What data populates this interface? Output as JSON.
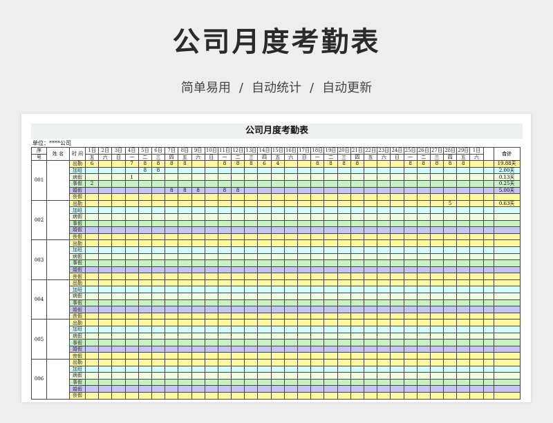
{
  "page": {
    "title": "公司月度考勤表",
    "subtitle": [
      "简单易用",
      "自动统计",
      "自动更新"
    ],
    "separator": "/"
  },
  "sheet": {
    "title": "公司月度考勤表",
    "unit": "单位：****公司",
    "headers": {
      "seq_top": "序",
      "seq_bottom": "号",
      "name": "姓 名",
      "time": "时 间",
      "total": "合计"
    },
    "days": [
      "1日",
      "2日",
      "3日",
      "4日",
      "5日",
      "6日",
      "7日",
      "8日",
      "9日",
      "10日",
      "11日",
      "12日",
      "13日",
      "14日",
      "15日",
      "16日",
      "17日",
      "18日",
      "19日",
      "20日",
      "21日",
      "22日",
      "23日",
      "24日",
      "25日",
      "26日",
      "27日",
      "28日",
      "29日",
      "1日"
    ],
    "weekdays": [
      "五",
      "六",
      "日",
      "一",
      "二",
      "三",
      "四",
      "五",
      "六",
      "日",
      "一",
      "二",
      "三",
      "四",
      "五",
      "六",
      "日",
      "一",
      "二",
      "三",
      "四",
      "五",
      "六",
      "日",
      "一",
      "二",
      "三",
      "四",
      "五",
      "六"
    ],
    "categories": [
      "出勤",
      "加班",
      "病假",
      "事假",
      "婚假",
      "丧假"
    ],
    "employees": [
      {
        "id": "001",
        "rows": [
          {
            "cells": {
              "0": "6",
              "3": "7",
              "4": "8",
              "5": "8",
              "6": "8",
              "7": "8",
              "10": "8",
              "11": "8",
              "12": "8",
              "13": "6",
              "14": "4",
              "17": "8",
              "18": "8",
              "19": "8",
              "20": "8",
              "24": "8",
              "25": "8",
              "26": "8",
              "27": "8",
              "28": "8"
            },
            "total": "19.88天"
          },
          {
            "cells": {
              "4": "8",
              "5": "8"
            },
            "total": "2.00天"
          },
          {
            "cells": {
              "3": "1"
            },
            "total": "0.13天"
          },
          {
            "cells": {
              "0": "2"
            },
            "total": "0.25天"
          },
          {
            "cells": {
              "6": "8",
              "7": "8",
              "8": "8",
              "10": "8",
              "11": "8"
            },
            "total": "5.00天"
          },
          {
            "cells": {},
            "total": ""
          }
        ]
      },
      {
        "id": "002",
        "rows": [
          {
            "cells": {
              "27": "5"
            },
            "total": "0.63天"
          },
          {
            "cells": {},
            "total": ""
          },
          {
            "cells": {},
            "total": ""
          },
          {
            "cells": {},
            "total": ""
          },
          {
            "cells": {},
            "total": ""
          },
          {
            "cells": {},
            "total": ""
          }
        ]
      },
      {
        "id": "003",
        "rows": [
          {
            "cells": {},
            "total": ""
          },
          {
            "cells": {},
            "total": ""
          },
          {
            "cells": {},
            "total": ""
          },
          {
            "cells": {},
            "total": ""
          },
          {
            "cells": {},
            "total": ""
          },
          {
            "cells": {},
            "total": ""
          }
        ]
      },
      {
        "id": "004",
        "rows": [
          {
            "cells": {},
            "total": ""
          },
          {
            "cells": {},
            "total": ""
          },
          {
            "cells": {},
            "total": ""
          },
          {
            "cells": {},
            "total": ""
          },
          {
            "cells": {},
            "total": ""
          },
          {
            "cells": {},
            "total": ""
          }
        ]
      },
      {
        "id": "005",
        "rows": [
          {
            "cells": {},
            "total": ""
          },
          {
            "cells": {},
            "total": ""
          },
          {
            "cells": {},
            "total": ""
          },
          {
            "cells": {},
            "total": ""
          },
          {
            "cells": {},
            "total": ""
          },
          {
            "cells": {},
            "total": ""
          }
        ]
      },
      {
        "id": "006",
        "rows": [
          {
            "cells": {},
            "total": ""
          },
          {
            "cells": {},
            "total": ""
          },
          {
            "cells": {},
            "total": ""
          },
          {
            "cells": {},
            "total": ""
          },
          {
            "cells": {},
            "total": ""
          },
          {
            "cells": {},
            "total": ""
          }
        ]
      }
    ]
  }
}
